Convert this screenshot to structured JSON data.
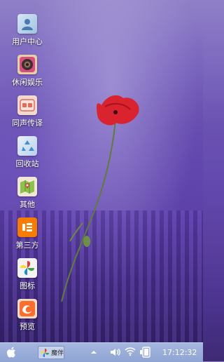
{
  "desktop": {
    "icons": [
      {
        "label": "用户中心",
        "icon": "user-center-icon"
      },
      {
        "label": "休闲娱乐",
        "icon": "entertainment-icon"
      },
      {
        "label": "同声传译",
        "icon": "translation-icon"
      },
      {
        "label": "回收站",
        "icon": "recycle-bin-icon"
      },
      {
        "label": "其他",
        "icon": "map-icon"
      },
      {
        "label": "第三方",
        "icon": "taobao-icon"
      },
      {
        "label": "图标",
        "icon": "pinwheel-icon"
      },
      {
        "label": "预览",
        "icon": "uc-browser-icon"
      }
    ]
  },
  "taskbar": {
    "start_icon": "apple-icon",
    "task_label": "魔伴",
    "clock": "17:12:32"
  },
  "colors": {
    "taskbar": "#8fa4d3",
    "accent_red": "#d9232e"
  }
}
